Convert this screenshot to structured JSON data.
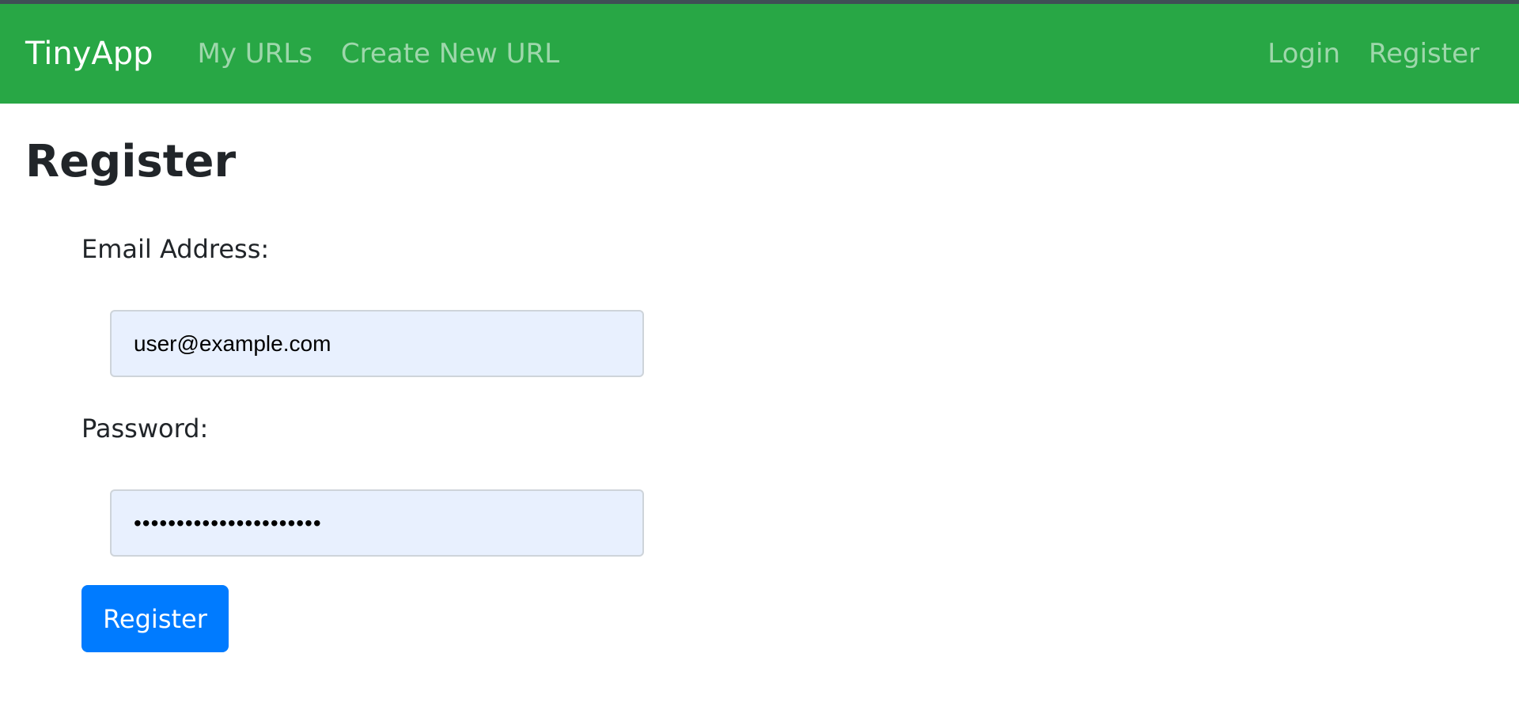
{
  "navbar": {
    "brand": "TinyApp",
    "left_links": [
      "My URLs",
      "Create New URL"
    ],
    "right_links": [
      "Login",
      "Register"
    ],
    "background_color": "#28a745"
  },
  "page": {
    "title": "Register"
  },
  "form": {
    "email_label": "Email Address:",
    "email_value": "user@example.com",
    "password_label": "Password:",
    "password_value": "••••••••••••••••••••••",
    "submit_label": "Register",
    "input_background": "#e8f0fe",
    "button_color": "#007bff"
  }
}
